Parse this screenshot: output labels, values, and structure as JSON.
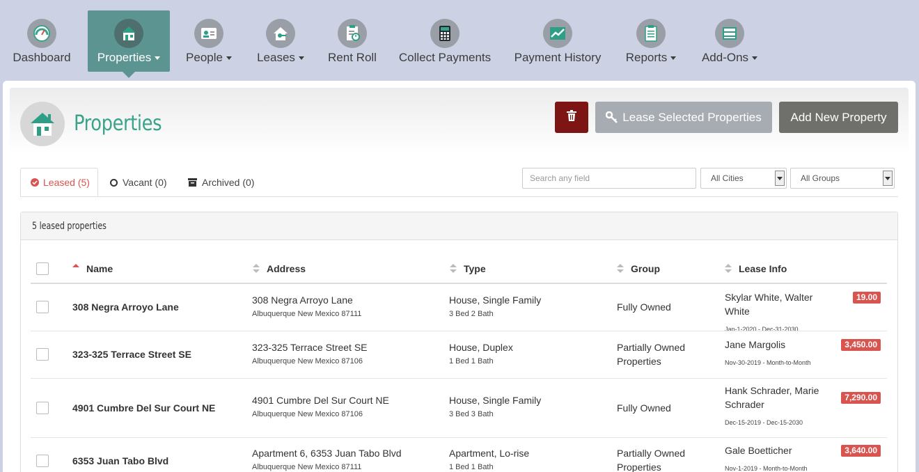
{
  "nav": {
    "items": [
      {
        "label": "Dashboard",
        "icon": "gauge-icon",
        "dropdown": false
      },
      {
        "label": "Properties",
        "icon": "house-icon",
        "dropdown": true,
        "active": true
      },
      {
        "label": "People",
        "icon": "id-card-icon",
        "dropdown": true
      },
      {
        "label": "Leases",
        "icon": "house-key-icon",
        "dropdown": true
      },
      {
        "label": "Rent Roll",
        "icon": "clipboard-clock-icon",
        "dropdown": false
      },
      {
        "label": "Collect Payments",
        "icon": "calculator-icon",
        "dropdown": false
      },
      {
        "label": "Payment History",
        "icon": "trend-chart-icon",
        "dropdown": false
      },
      {
        "label": "Reports",
        "icon": "clipboard-icon",
        "dropdown": true
      },
      {
        "label": "Add-Ons",
        "icon": "cabinet-icon",
        "dropdown": true
      }
    ]
  },
  "page": {
    "title": "Properties",
    "delete_button_icon": "trash-icon",
    "lease_selected_label": "Lease Selected Properties",
    "add_new_label": "Add New Property"
  },
  "tabs": {
    "leased": "Leased (5)",
    "vacant": "Vacant (0)",
    "archived": "Archived (0)"
  },
  "filters": {
    "search_placeholder": "Search any field",
    "city_value": "All Cities",
    "group_value": "All Groups"
  },
  "table": {
    "summary": "5 leased properties",
    "headers": {
      "name": "Name",
      "address": "Address",
      "type": "Type",
      "group": "Group",
      "lease_info": "Lease Info"
    },
    "rows": [
      {
        "name": "308 Negra Arroyo Lane",
        "address": "308 Negra Arroyo Lane",
        "city": "Albuquerque New Mexico 87111",
        "type": "House, Single Family",
        "rooms": "3 Bed  2 Bath",
        "group": "Fully Owned",
        "tenants": "Skylar White, Walter White",
        "dates": "Jan-1-2020 - Dec-31-2030",
        "amount": "19.00"
      },
      {
        "name": "323-325 Terrace Street SE",
        "address": "323-325 Terrace Street SE",
        "city": "Albuquerque New Mexico 87106",
        "type": "House, Duplex",
        "rooms": "1 Bed  1 Bath",
        "group": "Partially Owned Properties",
        "tenants": "Jane Margolis",
        "dates": "Nov-30-2019 - Month-to-Month",
        "amount": "3,450.00"
      },
      {
        "name": "4901 Cumbre Del Sur Court NE",
        "address": "4901 Cumbre Del Sur Court NE",
        "city": "Albuquerque New Mexico 87106",
        "type": "House, Single Family",
        "rooms": "3 Bed  3 Bath",
        "group": "Fully Owned",
        "tenants": "Hank Schrader, Marie Schrader",
        "dates": "Dec-15-2019 - Dec-15-2030",
        "amount": "7,290.00"
      },
      {
        "name": "6353 Juan Tabo Blvd",
        "address": "Apartment 6, 6353 Juan Tabo Blvd",
        "city": "Albuquerque New Mexico 87111",
        "type": "Apartment, Lo-rise",
        "rooms": "1 Bed  1 Bath",
        "group": "Partially Owned Properties",
        "tenants": "Gale Boetticher",
        "dates": "Nov-1-2019 - Month-to-Month",
        "amount": "3,640.00"
      }
    ]
  }
}
